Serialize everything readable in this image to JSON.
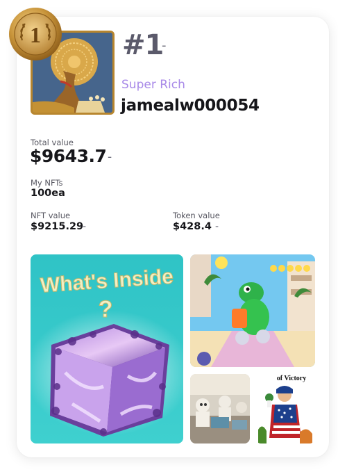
{
  "rank": {
    "label": "#1",
    "change": "-",
    "medal_number": "1"
  },
  "user": {
    "tier": "Super Rich",
    "username": "jamealw000054"
  },
  "total": {
    "label": "Total value",
    "value": "$9643.7",
    "change": "-"
  },
  "nfts": {
    "label": "My NFTs",
    "value": "100ea"
  },
  "nft_value": {
    "label": "NFT value",
    "value": "$9215.29",
    "change": "-"
  },
  "token_value": {
    "label": "Token value",
    "value": "$428.4",
    "change": "-"
  },
  "gallery": {
    "main_title": "What's Inside",
    "main_mark": "?",
    "poster_text": "of Victory"
  },
  "colors": {
    "tier": "#a889e8",
    "medal": "#c99a3c",
    "rank": "#5b5a6b"
  }
}
